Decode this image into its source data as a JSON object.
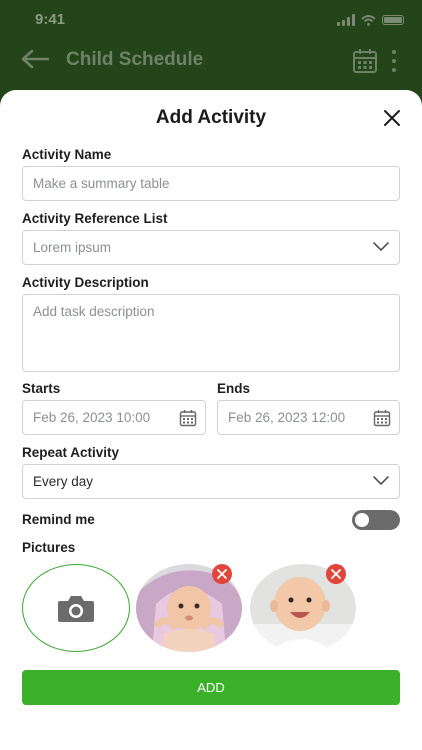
{
  "status_bar": {
    "time": "9:41"
  },
  "app_bar": {
    "title": "Child Schedule"
  },
  "modal": {
    "title": "Add Activity",
    "activity_name": {
      "label": "Activity Name",
      "placeholder": "Make a summary table"
    },
    "reference_list": {
      "label": "Activity Reference List",
      "selected": "Lorem ipsum"
    },
    "description": {
      "label": "Activity Description",
      "placeholder": "Add task description"
    },
    "starts": {
      "label": "Starts",
      "value": "Feb 26, 2023 10:00"
    },
    "ends": {
      "label": "Ends",
      "value": "Feb 26, 2023 12:00"
    },
    "repeat": {
      "label": "Repeat Activity",
      "selected": "Every day"
    },
    "remind": {
      "label": "Remind me",
      "enabled": false
    },
    "pictures": {
      "label": "Pictures",
      "count": 2
    },
    "add_button": "ADD"
  },
  "colors": {
    "accent": "#3caf2b",
    "remove": "#e2453c",
    "appbar": "#234519"
  },
  "icons": [
    "back-arrow-icon",
    "calendar-icon",
    "more-vertical-icon",
    "close-icon",
    "chevron-down-icon",
    "camera-icon",
    "remove-icon"
  ]
}
